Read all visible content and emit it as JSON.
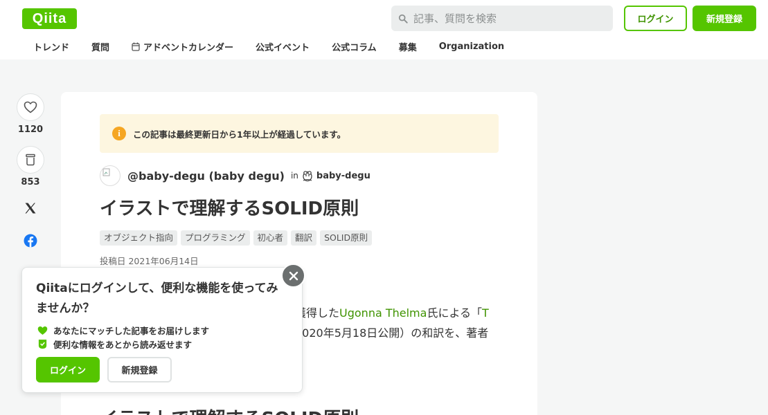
{
  "header": {
    "logo": "Qiita",
    "search_placeholder": "記事、質問を検索",
    "login_label": "ログイン",
    "signup_label": "新規登録"
  },
  "nav": {
    "items": [
      {
        "label": "トレンド"
      },
      {
        "label": "質問"
      },
      {
        "label": "アドベントカレンダー",
        "icon": "calendar-icon"
      },
      {
        "label": "公式イベント"
      },
      {
        "label": "公式コラム"
      },
      {
        "label": "募集"
      },
      {
        "label": "Organization"
      }
    ]
  },
  "sidebar_actions": {
    "like_count": "1120",
    "stock_count": "853",
    "icons": [
      "heart-icon",
      "stock-icon",
      "x-icon",
      "facebook-icon"
    ]
  },
  "article": {
    "notice": "この記事は最終更新日から1年以上が経過しています。",
    "author": "@baby-degu (baby degu)",
    "in_label": "in",
    "organization": "baby-degu",
    "title": "イラストで理解するSOLID原則",
    "tags": [
      "オブジェクト指向",
      "プログラミング",
      "初心者",
      "翻訳",
      "SOLID原則"
    ],
    "posted_date": "投稿日 2021年06月14日",
    "body_line1_prefix": "獲得した",
    "body_line1_link": "Ugonna Thelma",
    "body_line1_suffix": "氏による「",
    "body_line1_tail_link": "T",
    "body_line2": "2020年5月18日公開）の和訳を、著者",
    "heading2": "イラストで理解するSOLID原則"
  },
  "popup": {
    "title": "Qiitaにログインして、便利な機能を使ってみませんか？",
    "feature1": "あなたにマッチした記事をお届けします",
    "feature2": "便利な情報をあとから読み返せます",
    "login_label": "ログイン",
    "signup_label": "新規登録"
  },
  "colors": {
    "brand_green": "#55c500",
    "link_green": "#3f9300",
    "notice_bg": "#fdf6e0",
    "notice_icon": "#f5a623",
    "facebook_blue": "#1877f2"
  }
}
